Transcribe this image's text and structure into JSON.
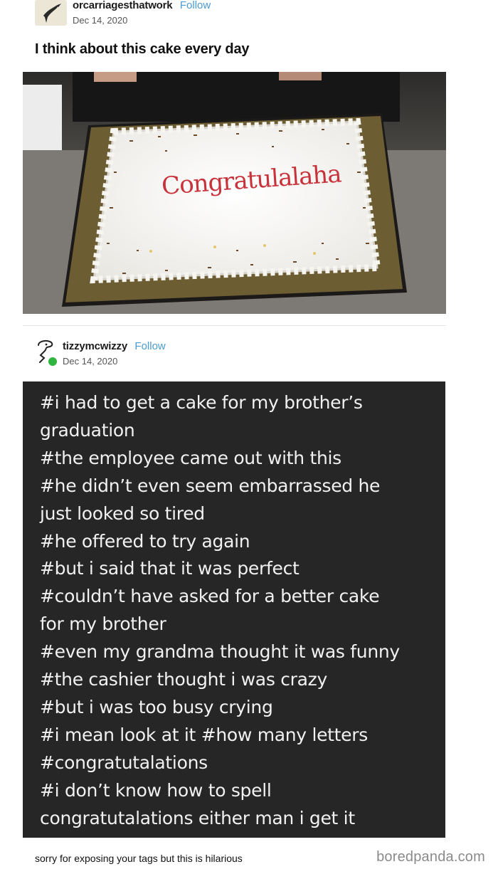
{
  "original_post": {
    "username": "orcarriagesthatwork",
    "follow_label": "Follow",
    "date": "Dec 14, 2020",
    "title": "I think about this cake every day",
    "cake_text": "Congratulalaha"
  },
  "reblog": {
    "username": "tizzymcwizzy",
    "follow_label": "Follow",
    "date": "Dec 14, 2020",
    "tags": [
      "#i had to get a cake for my brother’s",
      "graduation",
      "#the employee came out with this",
      "#he didn’t even seem embarrassed he",
      "just looked so tired",
      "#he offered to try again",
      "#but i said that it was perfect",
      "#couldn’t have asked for a better cake",
      "for my brother",
      "#even my grandma thought it was funny",
      "#the cashier thought i was crazy",
      "#but i was too busy crying",
      "#i mean look at it  #how many letters",
      "#congratutalations",
      "#i don’t know how to spell",
      "congratutalations either man i get it"
    ]
  },
  "footer": {
    "caption": "sorry for exposing your tags but this is hilarious",
    "watermark": "boredpanda.com"
  },
  "colors": {
    "follow_link": "#4a9bd0",
    "tags_background": "#262626",
    "online_indicator": "#2fb53e",
    "icing_text": "#c8323a"
  },
  "icons": [
    "bird-avatar-icon",
    "doodle-avatar-icon",
    "online-dot-icon"
  ]
}
